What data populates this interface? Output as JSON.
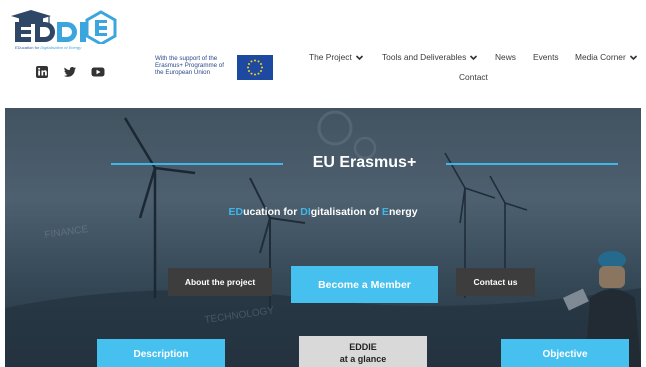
{
  "header": {
    "logo_text": "EDDIE",
    "logo_tagline_prefix": "EDucation for ",
    "logo_tagline_italic": "Digitalisation of Energy",
    "social": [
      {
        "icon": "linkedin-icon"
      },
      {
        "icon": "twitter-icon"
      },
      {
        "icon": "youtube-icon"
      }
    ],
    "eu_support_text": "With the support of the Erasmus+ Programme of the European Union"
  },
  "nav": {
    "items": [
      {
        "label": "The Project",
        "has_dropdown": true
      },
      {
        "label": "Tools and Deliverables",
        "has_dropdown": true
      },
      {
        "label": "News",
        "has_dropdown": false
      },
      {
        "label": "Events",
        "has_dropdown": false
      },
      {
        "label": "Media Corner",
        "has_dropdown": true
      },
      {
        "label": "Contact",
        "has_dropdown": false
      }
    ]
  },
  "hero": {
    "title": "EU Erasmus+",
    "subtitle_parts": [
      "ED",
      "ucation for ",
      "D",
      "I",
      "gitalisation of ",
      "E",
      "nergy"
    ],
    "background_words": [
      "FINANCE",
      "TECHNOLOGY"
    ],
    "buttons": {
      "about": "About the project",
      "member": "Become a Member",
      "contact": "Contact us"
    },
    "cards": {
      "description": "Description",
      "eddie_line1": "EDDIE",
      "eddie_line2": "at a glance",
      "objective": "Objective"
    }
  },
  "colors": {
    "accent": "#45c0ef",
    "dark_button": "#3d3d3d",
    "nav_text": "#3b3b3b",
    "eu_blue": "#1d4aa0"
  }
}
